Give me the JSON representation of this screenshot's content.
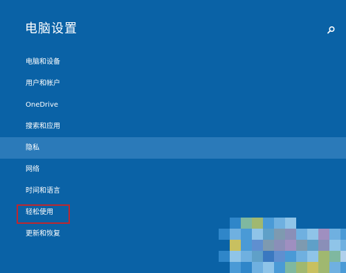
{
  "window": {
    "title": "电脑设置",
    "search_icon": "search-icon"
  },
  "nav": {
    "items": [
      {
        "label": "电脑和设备",
        "selected": false
      },
      {
        "label": "用户和帐户",
        "selected": false
      },
      {
        "label": "OneDrive",
        "selected": false
      },
      {
        "label": "搜索和应用",
        "selected": false
      },
      {
        "label": "隐私",
        "selected": true
      },
      {
        "label": "网络",
        "selected": false
      },
      {
        "label": "时间和语言",
        "selected": false
      },
      {
        "label": "轻松使用",
        "selected": false,
        "highlighted": true
      },
      {
        "label": "更新和恢复",
        "selected": false
      }
    ]
  },
  "colors": {
    "background": "#0a62a6",
    "selected_row": "#2b7ab9",
    "highlight_box": "#c0262c",
    "text": "#ffffff"
  }
}
